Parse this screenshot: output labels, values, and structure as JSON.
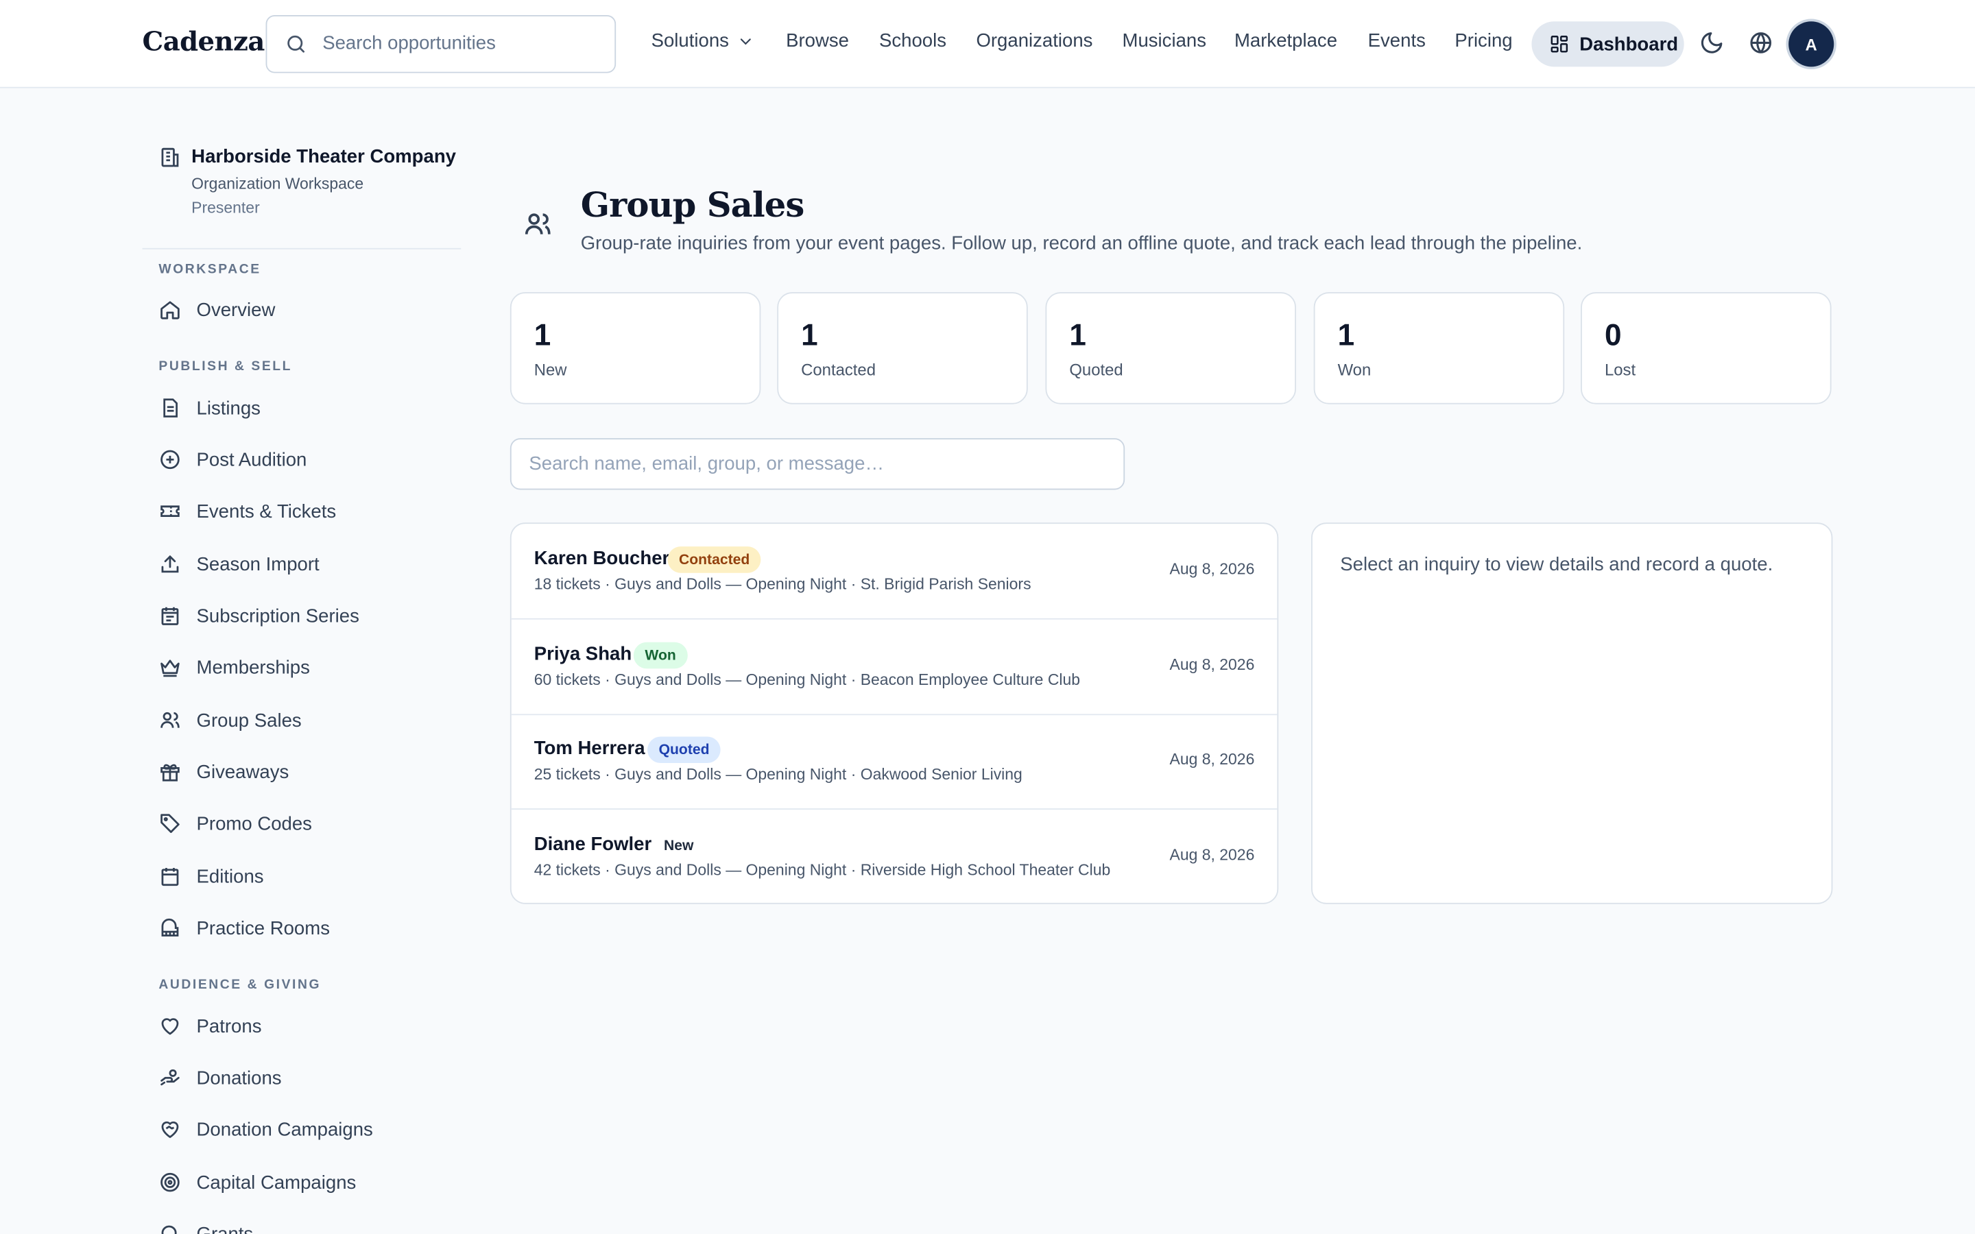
{
  "brand": "Cadenza",
  "top_search": {
    "placeholder": "Search opportunities"
  },
  "nav": {
    "solutions": "Solutions",
    "links": [
      "Browse",
      "Schools",
      "Organizations",
      "Musicians",
      "Marketplace",
      "Events",
      "Pricing"
    ],
    "dashboard": "Dashboard",
    "avatar_initial": "A"
  },
  "org": {
    "name": "Harborside Theater Company",
    "workspace": "Organization Workspace",
    "role": "Presenter"
  },
  "sidebar": {
    "sections": [
      {
        "title": "WORKSPACE",
        "items": [
          "Overview"
        ]
      },
      {
        "title": "PUBLISH & SELL",
        "items": [
          "Listings",
          "Post Audition",
          "Events & Tickets",
          "Season Import",
          "Subscription Series",
          "Memberships",
          "Group Sales",
          "Giveaways",
          "Promo Codes",
          "Editions",
          "Practice Rooms"
        ]
      },
      {
        "title": "AUDIENCE & GIVING",
        "items": [
          "Patrons",
          "Donations",
          "Donation Campaigns",
          "Capital Campaigns",
          "Grants"
        ]
      }
    ]
  },
  "page": {
    "title": "Group Sales",
    "subtitle": "Group-rate inquiries from your event pages. Follow up, record an offline quote, and track each lead through the pipeline."
  },
  "stats": [
    {
      "value": "1",
      "label": "New"
    },
    {
      "value": "1",
      "label": "Contacted"
    },
    {
      "value": "1",
      "label": "Quoted"
    },
    {
      "value": "1",
      "label": "Won"
    },
    {
      "value": "0",
      "label": "Lost"
    }
  ],
  "list_search": {
    "placeholder": "Search name, email, group, or message…"
  },
  "inquiries": [
    {
      "name": "Karen Boucher",
      "status": "Contacted",
      "meta": "18 tickets · Guys and Dolls — Opening Night · St. Brigid Parish Seniors",
      "date": "Aug 8, 2026"
    },
    {
      "name": "Priya Shah",
      "status": "Won",
      "meta": "60 tickets · Guys and Dolls — Opening Night · Beacon Employee Culture Club",
      "date": "Aug 8, 2026"
    },
    {
      "name": "Tom Herrera",
      "status": "Quoted",
      "meta": "25 tickets · Guys and Dolls — Opening Night · Oakwood Senior Living",
      "date": "Aug 8, 2026"
    },
    {
      "name": "Diane Fowler",
      "status": "New",
      "meta": "42 tickets · Guys and Dolls — Opening Night · Riverside High School Theater Club",
      "date": "Aug 8, 2026"
    }
  ],
  "detail": {
    "empty_message": "Select an inquiry to view details and record a quote."
  },
  "colors": {
    "contacted_bg": "#fdf0c4",
    "contacted_fg": "#92400e",
    "won_bg": "#dcfce7",
    "won_fg": "#166534",
    "quoted_bg": "#dbeafe",
    "quoted_fg": "#1e40af",
    "new_bg": "#ffffff",
    "new_fg": "#1e293b"
  }
}
